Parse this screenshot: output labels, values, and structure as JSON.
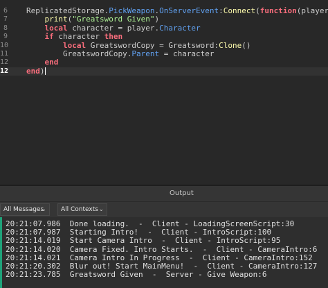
{
  "editor": {
    "lines": [
      {
        "num": "6",
        "tokens": [
          {
            "t": "ReplicatedStorage.",
            "c": "txt"
          },
          {
            "t": "PickWeapon",
            "c": "prop"
          },
          {
            "t": ".",
            "c": "txt"
          },
          {
            "t": "OnServerEvent",
            "c": "prop"
          },
          {
            "t": ":",
            "c": "txt"
          },
          {
            "t": "Connect",
            "c": "fn"
          },
          {
            "t": "(",
            "c": "txt"
          },
          {
            "t": "function",
            "c": "kw"
          },
          {
            "t": "(player)",
            "c": "txt"
          }
        ]
      },
      {
        "num": "7",
        "tokens": [
          {
            "t": "    ",
            "c": "txt"
          },
          {
            "t": "print",
            "c": "fn"
          },
          {
            "t": "(",
            "c": "txt"
          },
          {
            "t": "\"Greatsword Given\"",
            "c": "str"
          },
          {
            "t": ")",
            "c": "txt"
          }
        ]
      },
      {
        "num": "8",
        "tokens": [
          {
            "t": "    ",
            "c": "txt"
          },
          {
            "t": "local",
            "c": "kw"
          },
          {
            "t": " character = player.",
            "c": "txt"
          },
          {
            "t": "Character",
            "c": "prop"
          }
        ]
      },
      {
        "num": "9",
        "tokens": [
          {
            "t": "    ",
            "c": "txt"
          },
          {
            "t": "if",
            "c": "kw"
          },
          {
            "t": " character ",
            "c": "txt"
          },
          {
            "t": "then",
            "c": "kw"
          }
        ]
      },
      {
        "num": "10",
        "tokens": [
          {
            "t": "        ",
            "c": "txt"
          },
          {
            "t": "local",
            "c": "kw"
          },
          {
            "t": " GreatswordCopy = Greatsword:",
            "c": "txt"
          },
          {
            "t": "Clone",
            "c": "fn"
          },
          {
            "t": "()",
            "c": "txt"
          }
        ]
      },
      {
        "num": "11",
        "tokens": [
          {
            "t": "        GreatswordCopy.",
            "c": "txt"
          },
          {
            "t": "Parent",
            "c": "prop"
          },
          {
            "t": " = character",
            "c": "txt"
          }
        ]
      },
      {
        "num": "12",
        "tokens": [
          {
            "t": "    ",
            "c": "txt"
          },
          {
            "t": "end",
            "c": "kw"
          }
        ]
      },
      {
        "num": "12",
        "tokens": [
          {
            "t": "end",
            "c": "kw"
          },
          {
            "t": ")",
            "c": "txt"
          }
        ],
        "current": true
      }
    ]
  },
  "output": {
    "title": "Output",
    "filters": {
      "messages_label": "All Messages",
      "contexts_label": "All Contexts"
    },
    "log": [
      "20:21:07.986  Done loading.  -  Client - LoadingScreenScript:30",
      "20:21:07.987  Starting Intro!  -  Client - IntroScript:100",
      "20:21:14.019  Start Camera Intro  -  Client - IntroScript:95",
      "20:21:14.020  Camera Fixed. Intro Starts.  -  Client - CameraIntro:6",
      "20:21:14.021  Camera Intro In Progress  -  Client - CameraIntro:152",
      "20:21:20.302  Blur out! Start MainMenu!  -  Client - CameraIntro:127",
      "20:21:23.785  Greatsword Given  -  Server - Give Weapon:6"
    ]
  },
  "colors": {
    "editor_bg": "#282828",
    "keyword": "#f86d7c",
    "function": "#fdfbac",
    "property": "#61a1f1",
    "string": "#adf195",
    "text": "#cccccc",
    "output_accent": "#1fa37a"
  },
  "icons": {
    "dropdown": "chevron-down-icon"
  }
}
